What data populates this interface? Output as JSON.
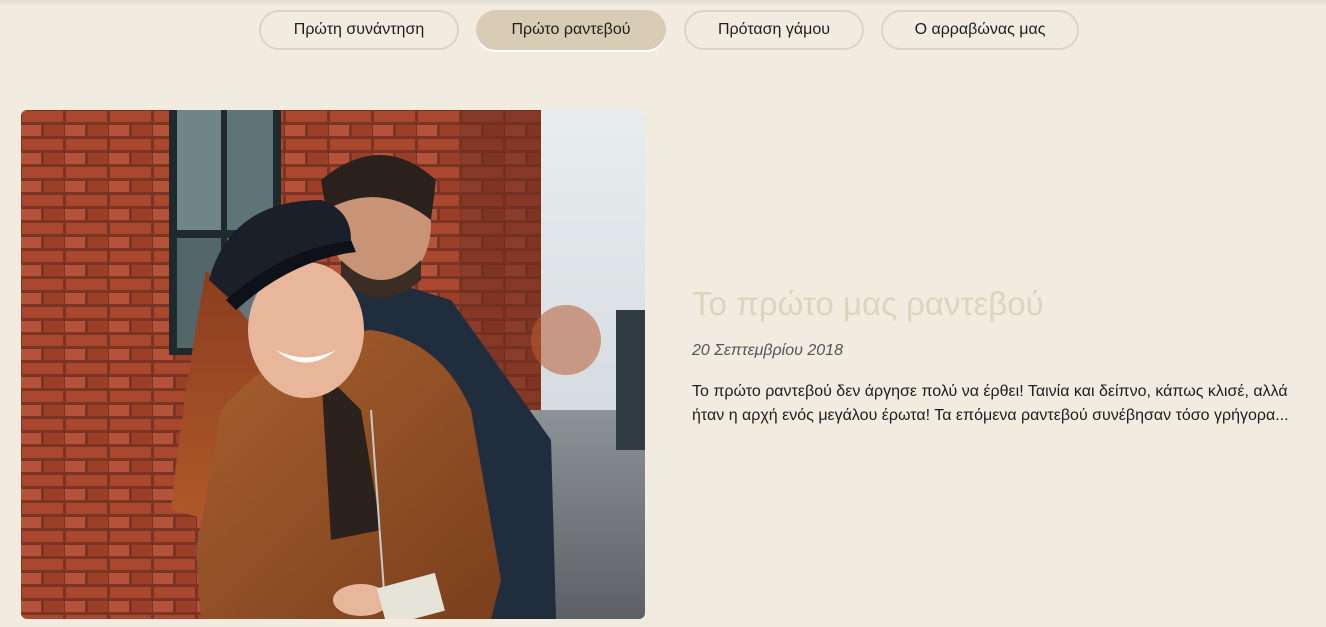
{
  "tabs": [
    {
      "label": "Πρώτη συνάντηση",
      "active": false
    },
    {
      "label": "Πρώτο ραντεβού",
      "active": true
    },
    {
      "label": "Πρόταση γάμου",
      "active": false
    },
    {
      "label": "Ο αρραβώνας μας",
      "active": false
    }
  ],
  "story": {
    "title": "Το πρώτο μας ραντεβού",
    "date": "20 Σεπτεμβρίου 2018",
    "text": "Το πρώτο ραντεβού δεν άργησε πολύ να έρθει! Ταινία και δείπνο, κάπως κλισέ, αλλά ήταν η αρχή ενός μεγάλου έρωτα! Τα επόμενα ραντεβού συνέβησαν τόσο γρήγορα..."
  },
  "colors": {
    "background": "#f2ece0",
    "tab_border": "#ddd3bf",
    "tab_active": "#d8ccb4",
    "title": "#ddd3bf"
  },
  "icons": {
    "photo": "couple-photo"
  }
}
